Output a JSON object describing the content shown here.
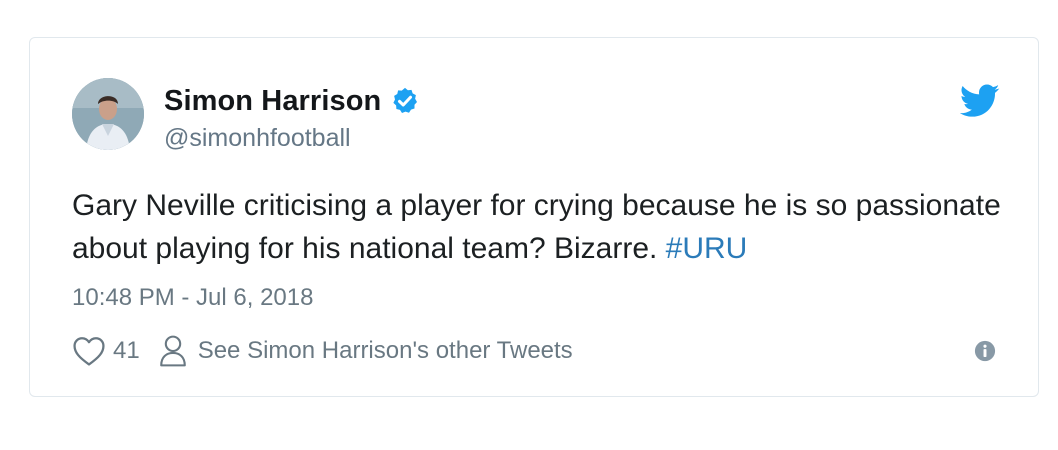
{
  "tweet": {
    "display_name": "Simon Harrison",
    "handle": "@simonhfootball",
    "text_main": "Gary Neville criticising a player for crying because he is so passionate about playing for his national team? Bizarre. ",
    "hashtag": "#URU",
    "timestamp": "10:48 PM - Jul 6, 2018",
    "like_count": "41",
    "see_other_tweets": "See Simon Harrison's other Tweets"
  },
  "icons": {
    "verified": "verified-badge-icon",
    "logo": "twitter-bird-icon",
    "like": "heart-icon",
    "profile": "person-icon",
    "info": "info-icon"
  },
  "colors": {
    "verified_blue": "#1da1f2",
    "twitter_blue": "#1da1f2",
    "hashtag": "#2b7bb9",
    "secondary_text": "#697882"
  }
}
